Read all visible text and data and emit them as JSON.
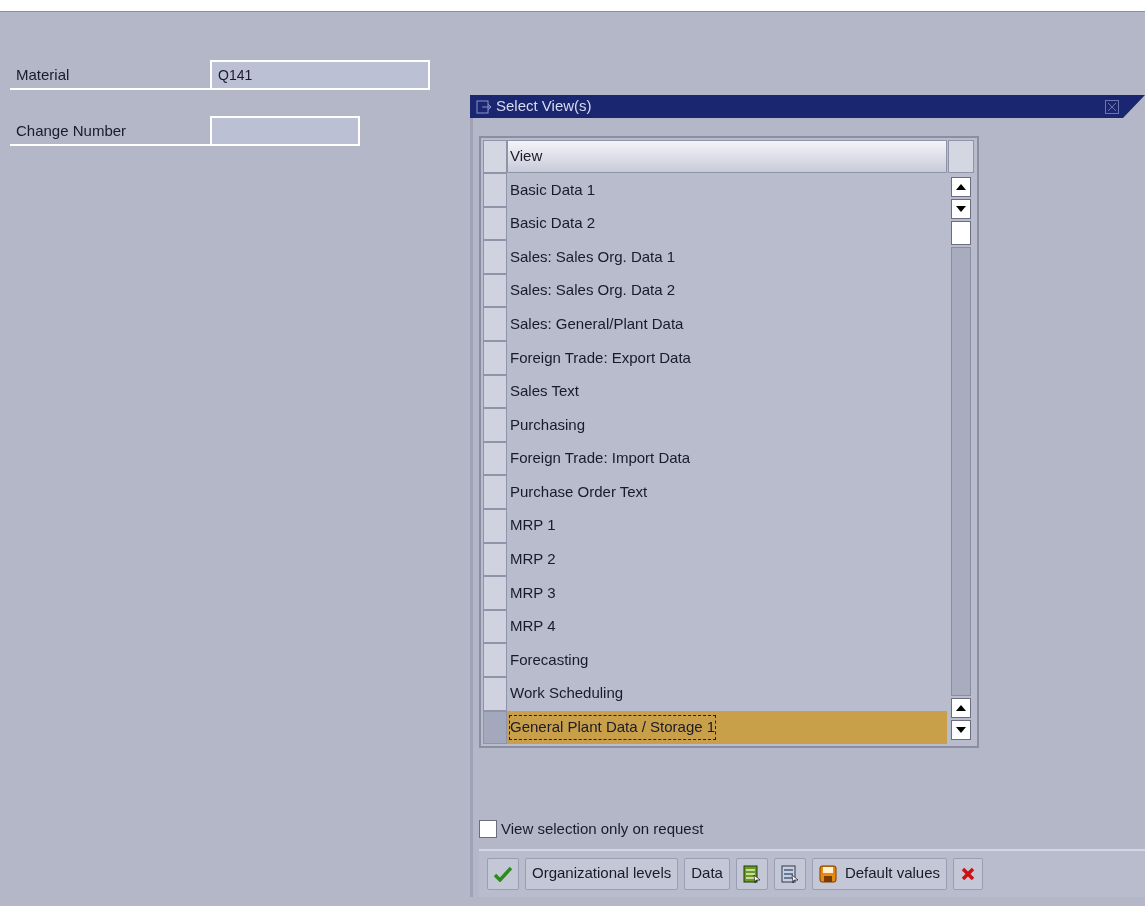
{
  "fields": [
    {
      "label": "Material",
      "value": "Q141"
    },
    {
      "label": "Change Number"
    }
  ],
  "dialog": {
    "title": "Select View(s)",
    "table": {
      "columns": [
        "View"
      ],
      "rows": [
        {
          "view": "Basic Data 1",
          "selected": false
        },
        {
          "view": "Basic Data 2",
          "selected": false
        },
        {
          "view": "Sales: Sales Org. Data 1",
          "selected": false
        },
        {
          "view": "Sales: Sales Org. Data 2",
          "selected": false
        },
        {
          "view": "Sales: General/Plant Data",
          "selected": false
        },
        {
          "view": "Foreign Trade: Export Data",
          "selected": false
        },
        {
          "view": "Sales Text",
          "selected": false
        },
        {
          "view": "Purchasing",
          "selected": false
        },
        {
          "view": "Foreign Trade: Import Data",
          "selected": false
        },
        {
          "view": "Purchase Order Text",
          "selected": false
        },
        {
          "view": "MRP 1",
          "selected": false
        },
        {
          "view": "MRP 2",
          "selected": false
        },
        {
          "view": "MRP 3",
          "selected": false
        },
        {
          "view": "MRP 4",
          "selected": false
        },
        {
          "view": "Forecasting",
          "selected": false
        },
        {
          "view": "Work Scheduling",
          "selected": false
        },
        {
          "view": "General Plant Data / Storage 1",
          "selected": true
        }
      ]
    },
    "option": {
      "label": "View selection only on request",
      "checked": false
    },
    "buttons": [
      {
        "kind": "check"
      },
      {
        "kind": "text",
        "label": "Organizational levels"
      },
      {
        "kind": "text",
        "label": "Data"
      },
      {
        "kind": "select-all"
      },
      {
        "kind": "deselect-all"
      },
      {
        "kind": "save",
        "label": "Default values"
      },
      {
        "kind": "cancel"
      }
    ]
  }
}
